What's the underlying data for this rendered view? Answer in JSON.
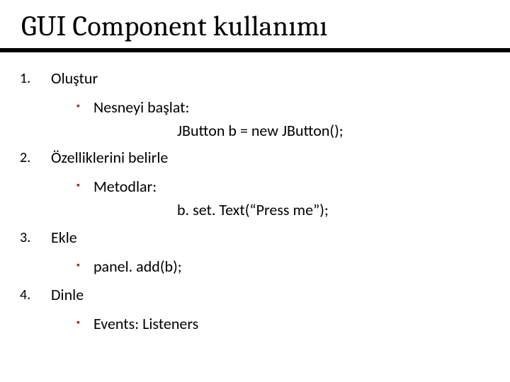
{
  "title": "GUI Component kullanımı",
  "items": {
    "n1": "1.",
    "t1": "Oluştur",
    "s1_label": "Nesneyi başlat:",
    "s1_code": "JButton b = new JButton();",
    "n2": "2.",
    "t2": "Özelliklerini belirle",
    "s2_label": "Metodlar:",
    "s2_code": "b. set. Text(“Press me”);",
    "n3": "3.",
    "t3": "Ekle",
    "s3_label": "panel. add(b);",
    "n4": "4.",
    "t4": "Dinle",
    "s4_label": "Events:   Listeners"
  }
}
